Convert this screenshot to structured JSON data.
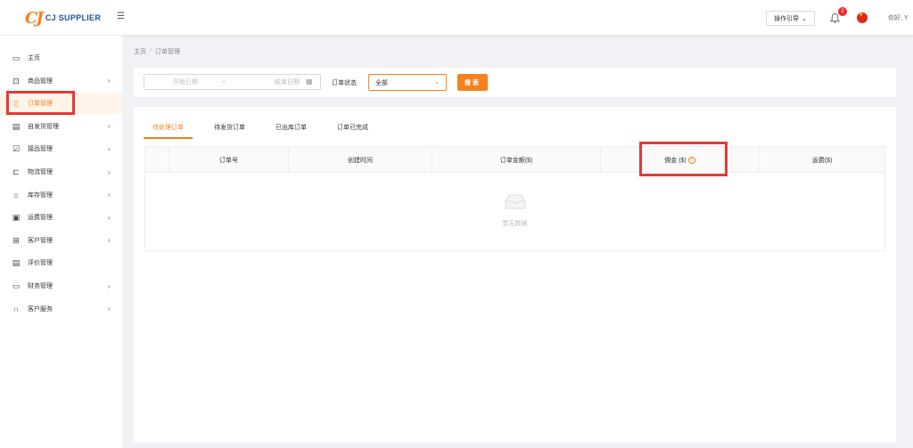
{
  "header": {
    "logo_mark": "CJ",
    "logo_text": "CJ SUPPLIER",
    "guide_label": "操作引导",
    "notification_count": "2",
    "greeting": "你好, Y"
  },
  "sidebar": {
    "items": [
      {
        "label": "主页",
        "icon": "monitor-icon",
        "glyph": "▭",
        "arrow": false,
        "active": false
      },
      {
        "label": "商品管理",
        "icon": "box-icon",
        "glyph": "⊡",
        "arrow": true,
        "active": false
      },
      {
        "label": "订单管理",
        "icon": "clipboard-icon",
        "glyph": "▯",
        "arrow": false,
        "active": true
      },
      {
        "label": "自发货管理",
        "icon": "shipping-list-icon",
        "glyph": "▤",
        "arrow": true,
        "active": false
      },
      {
        "label": "接品管理",
        "icon": "clipboard-check-icon",
        "glyph": "☑",
        "arrow": true,
        "active": false
      },
      {
        "label": "物流管理",
        "icon": "truck-icon",
        "glyph": "⊏",
        "arrow": true,
        "active": false
      },
      {
        "label": "库存管理",
        "icon": "warehouse-icon",
        "glyph": "⌂",
        "arrow": true,
        "active": false
      },
      {
        "label": "运费管理",
        "icon": "freight-icon",
        "glyph": "▣",
        "arrow": true,
        "active": false
      },
      {
        "label": "客户管理",
        "icon": "users-grid-icon",
        "glyph": "⊞",
        "arrow": true,
        "active": false
      },
      {
        "label": "评价管理",
        "icon": "review-icon",
        "glyph": "▤",
        "arrow": false,
        "active": false
      },
      {
        "label": "财务管理",
        "icon": "finance-icon",
        "glyph": "▭",
        "arrow": true,
        "active": false
      },
      {
        "label": "客户服务",
        "icon": "headset-icon",
        "glyph": "∩",
        "arrow": true,
        "active": false
      }
    ]
  },
  "breadcrumb": {
    "home": "主页",
    "sep": "/",
    "current": "订单管理"
  },
  "filter": {
    "date_start_placeholder": "开始日期",
    "date_sep": "~",
    "date_end_placeholder": "结束日期",
    "status_label": "订单状态",
    "status_value": "全部",
    "search_label": "搜索"
  },
  "tabs": [
    "待处理订单",
    "待发货订单",
    "已出库订单",
    "订单已完成"
  ],
  "active_tab": 0,
  "table": {
    "columns": [
      "",
      "订单号",
      "创建时间",
      "订单金额($)",
      "佣金 ($)",
      "运费($)"
    ],
    "empty_text": "暂无数据"
  },
  "colors": {
    "accent": "#f5811f",
    "highlight": "#e53935",
    "brand_blue": "#1e4fa0"
  }
}
